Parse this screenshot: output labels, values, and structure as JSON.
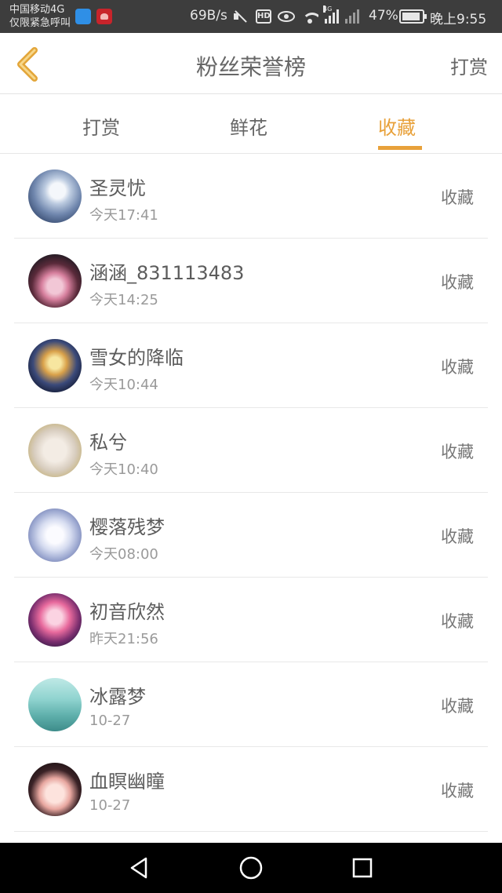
{
  "status_bar": {
    "carrier_line1": "中国移动4G",
    "carrier_line2": "仅限紧急呼叫",
    "speed": "69B/s",
    "hd": "HD",
    "net_label": "4G",
    "battery_pct": "47%",
    "time": "晚上9:55"
  },
  "header": {
    "title": "粉丝荣誉榜",
    "right_label": "打赏"
  },
  "tabs": [
    {
      "label": "打赏",
      "active": false
    },
    {
      "label": "鲜花",
      "active": false
    },
    {
      "label": "收藏",
      "active": true
    }
  ],
  "colors": {
    "accent": "#e8a13a",
    "back_arrow": "#e3a63a"
  },
  "list": [
    {
      "name": "圣灵忧",
      "time": "今天17:41",
      "action": "收藏"
    },
    {
      "name": "涵涵_831113483",
      "time": "今天14:25",
      "action": "收藏"
    },
    {
      "name": "雪女的降临",
      "time": "今天10:44",
      "action": "收藏"
    },
    {
      "name": "私兮",
      "time": "今天10:40",
      "action": "收藏"
    },
    {
      "name": "樱落残梦",
      "time": "今天08:00",
      "action": "收藏"
    },
    {
      "name": "初音欣然",
      "time": "昨天21:56",
      "action": "收藏"
    },
    {
      "name": "冰露梦",
      "time": "10-27",
      "action": "收藏"
    },
    {
      "name": "血瞑幽瞳",
      "time": "10-27",
      "action": "收藏"
    }
  ]
}
